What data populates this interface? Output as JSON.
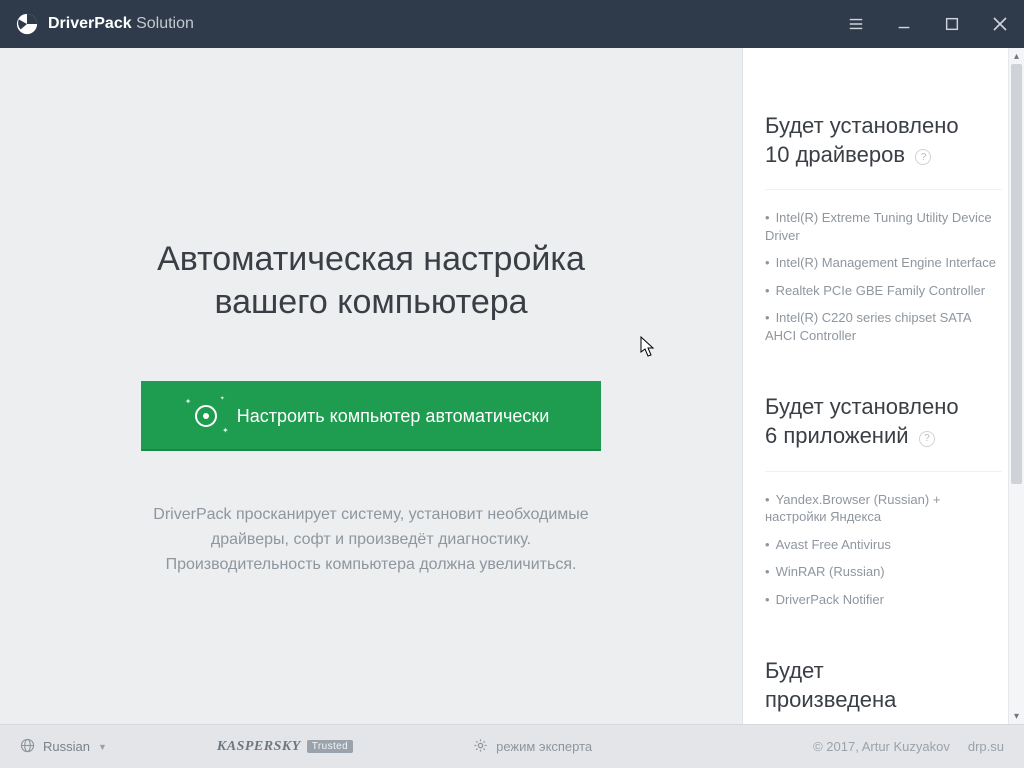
{
  "titlebar": {
    "app_name_bold": "DriverPack",
    "app_name_thin": "Solution"
  },
  "main": {
    "headline_line1": "Автоматическая настройка",
    "headline_line2": "вашего компьютера",
    "cta_label": "Настроить компьютер автоматически",
    "sub_line1": "DriverPack просканирует систему, установит необходимые",
    "sub_line2": "драйверы, софт и произведёт диагностику.",
    "sub_line3": "Производительность компьютера должна увеличиться."
  },
  "sidebar": {
    "drivers_heading_l1": "Будет установлено",
    "drivers_heading_l2": "10 драйверов",
    "drivers": [
      "Intel(R) Extreme Tuning Utility Device Driver",
      "Intel(R) Management Engine Interface",
      "Realtek PCIe GBE Family Controller",
      "Intel(R) C220 series chipset SATA AHCI Controller"
    ],
    "apps_heading_l1": "Будет установлено",
    "apps_heading_l2": "6 приложений",
    "apps": [
      "Yandex.Browser (Russian) + настройки Яндекса",
      "Avast Free Antivirus",
      "WinRAR (Russian)",
      "DriverPack Notifier"
    ],
    "diag_heading_l1": "Будет",
    "diag_heading_l2": "произведена",
    "help_symbol": "?"
  },
  "footer": {
    "language": "Russian",
    "kaspersky": "KASPERSKY",
    "trusted": "Trusted",
    "expert_mode": "режим эксперта",
    "copyright": "© 2017, Artur Kuzyakov",
    "site": "drp.su"
  }
}
